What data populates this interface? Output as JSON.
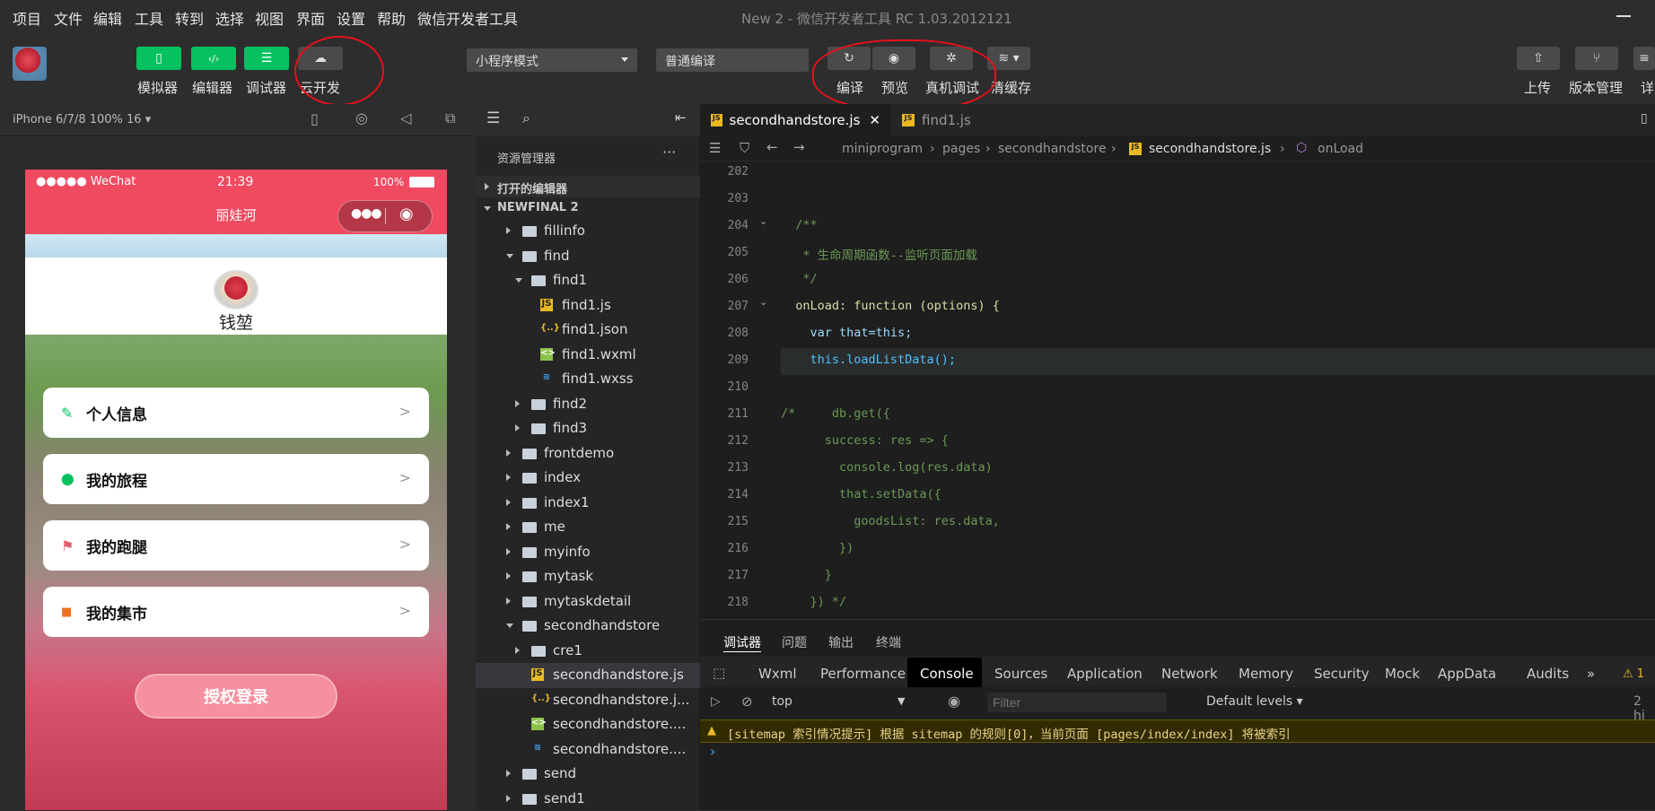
{
  "menu": [
    "项目",
    "文件",
    "编辑",
    "工具",
    "转到",
    "选择",
    "视图",
    "界面",
    "设置",
    "帮助",
    "微信开发者工具"
  ],
  "window_title": "New 2 - 微信开发者工具 RC 1.03.2012121",
  "toolbar": {
    "simulator": "模拟器",
    "editor": "编辑器",
    "debugger": "调试器",
    "cloud": "云开发",
    "mode": "小程序模式",
    "compile_mode": "普通编译",
    "compile": "编译",
    "preview": "预览",
    "real_debug": "真机调试",
    "clear_cache": "清缓存",
    "upload": "上传",
    "version": "版本管理",
    "detail": "详"
  },
  "device": "iPhone 6/7/8 100% 16 ▾",
  "phone": {
    "carrier": "●●●●● WeChat",
    "time": "21:39",
    "battery": "100%",
    "nav_title": "丽娃河",
    "username": "钱堃",
    "cards": [
      {
        "label": "个人信息",
        "icon": "pencil-icon",
        "color": "#07c160",
        "glyph": "✎"
      },
      {
        "label": "我的旅程",
        "icon": "location-pin-icon",
        "color": "#07c160",
        "glyph": "⬤"
      },
      {
        "label": "我的跑腿",
        "icon": "runner-icon",
        "color": "#e06070",
        "glyph": "⚑"
      },
      {
        "label": "我的集市",
        "icon": "shopping-bag-icon",
        "color": "#f07020",
        "glyph": "■"
      }
    ],
    "card_arrow": ">",
    "login": "授权登录"
  },
  "explorer": {
    "title": "资源管理器",
    "more": "···",
    "open_editors": "打开的编辑器",
    "project": "NEWFINAL 2",
    "items": [
      {
        "name": "fillinfo",
        "kind": "folder",
        "depth": 1,
        "open": false
      },
      {
        "name": "find",
        "kind": "folder",
        "depth": 1,
        "open": true
      },
      {
        "name": "find1",
        "kind": "folder",
        "depth": 2,
        "open": true
      },
      {
        "name": "find1.js",
        "kind": "js",
        "depth": 3
      },
      {
        "name": "find1.json",
        "kind": "json",
        "depth": 3
      },
      {
        "name": "find1.wxml",
        "kind": "wxml",
        "depth": 3
      },
      {
        "name": "find1.wxss",
        "kind": "wxss",
        "depth": 3
      },
      {
        "name": "find2",
        "kind": "folder",
        "depth": 2,
        "open": false
      },
      {
        "name": "find3",
        "kind": "folder",
        "depth": 2,
        "open": false
      },
      {
        "name": "frontdemo",
        "kind": "folder",
        "depth": 1,
        "open": false
      },
      {
        "name": "index",
        "kind": "folder",
        "depth": 1,
        "open": false
      },
      {
        "name": "index1",
        "kind": "folder",
        "depth": 1,
        "open": false
      },
      {
        "name": "me",
        "kind": "folder",
        "depth": 1,
        "open": false
      },
      {
        "name": "myinfo",
        "kind": "folder",
        "depth": 1,
        "open": false
      },
      {
        "name": "mytask",
        "kind": "folder",
        "depth": 1,
        "open": false
      },
      {
        "name": "mytaskdetail",
        "kind": "folder",
        "depth": 1,
        "open": false
      },
      {
        "name": "secondhandstore",
        "kind": "folder",
        "depth": 1,
        "open": true
      },
      {
        "name": "cre1",
        "kind": "folder",
        "depth": 2,
        "open": false
      },
      {
        "name": "secondhandstore.js",
        "kind": "js",
        "depth": 2,
        "selected": true
      },
      {
        "name": "secondhandstore.j...",
        "kind": "json",
        "depth": 2
      },
      {
        "name": "secondhandstore....",
        "kind": "wxml",
        "depth": 2
      },
      {
        "name": "secondhandstore....",
        "kind": "wxss",
        "depth": 2
      },
      {
        "name": "send",
        "kind": "folder",
        "depth": 1,
        "open": false
      },
      {
        "name": "send1",
        "kind": "folder",
        "depth": 1,
        "open": false
      }
    ]
  },
  "tabs": [
    {
      "label": "secondhandstore.js",
      "active": true
    },
    {
      "label": "find1.js",
      "active": false
    }
  ],
  "breadcrumb": [
    "miniprogram",
    "pages",
    "secondhandstore",
    "secondhandstore.js",
    "onLoad"
  ],
  "code": [
    {
      "ln": "202",
      "text": ""
    },
    {
      "ln": "203",
      "text": ""
    },
    {
      "ln": "204",
      "text": "  /**"
    },
    {
      "ln": "205",
      "text": "   * 生命周期函数--监听页面加载"
    },
    {
      "ln": "206",
      "text": "   */"
    },
    {
      "ln": "207",
      "text": "  onLoad: function (options) {"
    },
    {
      "ln": "208",
      "text": "    var that=this;"
    },
    {
      "ln": "209",
      "text": "    this.loadListData();"
    },
    {
      "ln": "210",
      "text": ""
    },
    {
      "ln": "211",
      "text": "/*     db.get({"
    },
    {
      "ln": "212",
      "text": "      success: res => {"
    },
    {
      "ln": "213",
      "text": "        console.log(res.data)"
    },
    {
      "ln": "214",
      "text": "        that.setData({"
    },
    {
      "ln": "215",
      "text": "          goodsList: res.data,"
    },
    {
      "ln": "216",
      "text": "        })"
    },
    {
      "ln": "217",
      "text": "      }"
    },
    {
      "ln": "218",
      "text": "    }) */"
    }
  ],
  "debug": {
    "tabs": [
      "调试器",
      "问题",
      "输出",
      "终端"
    ],
    "console_tabs": [
      "Wxml",
      "Performance",
      "Console",
      "Sources",
      "Application",
      "Network",
      "Memory",
      "Security",
      "Mock",
      "AppData",
      "Audits"
    ],
    "more": "»",
    "warn_count": "⚠ 1",
    "context": "top",
    "filter_placeholder": "Filter",
    "levels": "Default levels ▾",
    "hidden": "2 hi",
    "warning": "[sitemap 索引情况提示] 根据 sitemap 的规则[0]，当前页面 [pages/index/index] 将被索引",
    "prompt": "›"
  },
  "colors": {
    "accent": "#07c160",
    "nav": "#f04a61",
    "annotation": "#e8101a"
  }
}
